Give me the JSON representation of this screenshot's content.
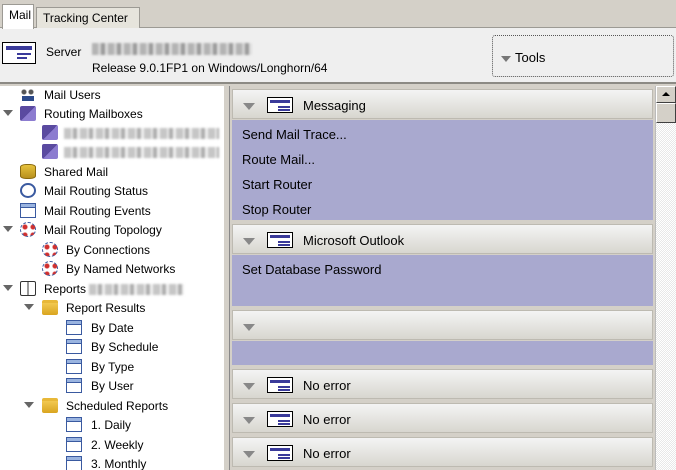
{
  "tabs": [
    {
      "label": "Mail",
      "active": true
    },
    {
      "label": "Tracking Center",
      "active": false
    }
  ],
  "header": {
    "server_label": "Server",
    "release": "Release 9.0.1FP1 on Windows/Longhorn/64",
    "tools_label": "Tools"
  },
  "tree": {
    "mail_users": "Mail Users",
    "routing_mailboxes": "Routing Mailboxes",
    "shared_mail": "Shared Mail",
    "mail_routing_status": "Mail Routing Status",
    "mail_routing_events": "Mail Routing Events",
    "mail_routing_topology": "Mail Routing Topology",
    "by_connections": "By Connections",
    "by_named_networks": "By Named Networks",
    "reports": "Reports",
    "report_results": "Report Results",
    "by_date": "By Date",
    "by_schedule": "By Schedule",
    "by_type": "By Type",
    "by_user": "By User",
    "scheduled_reports": "Scheduled Reports",
    "daily": "1. Daily",
    "weekly": "2. Weekly",
    "monthly": "3. Monthly"
  },
  "sections": {
    "messaging": {
      "title": "Messaging",
      "actions": [
        "Send Mail Trace...",
        "Route Mail...",
        "Start Router",
        "Stop Router"
      ]
    },
    "outlook": {
      "title": "Microsoft Outlook",
      "actions": [
        "Set Database Password"
      ]
    },
    "no_error_1": "No error",
    "no_error_2": "No error",
    "no_error_3": "No error"
  }
}
